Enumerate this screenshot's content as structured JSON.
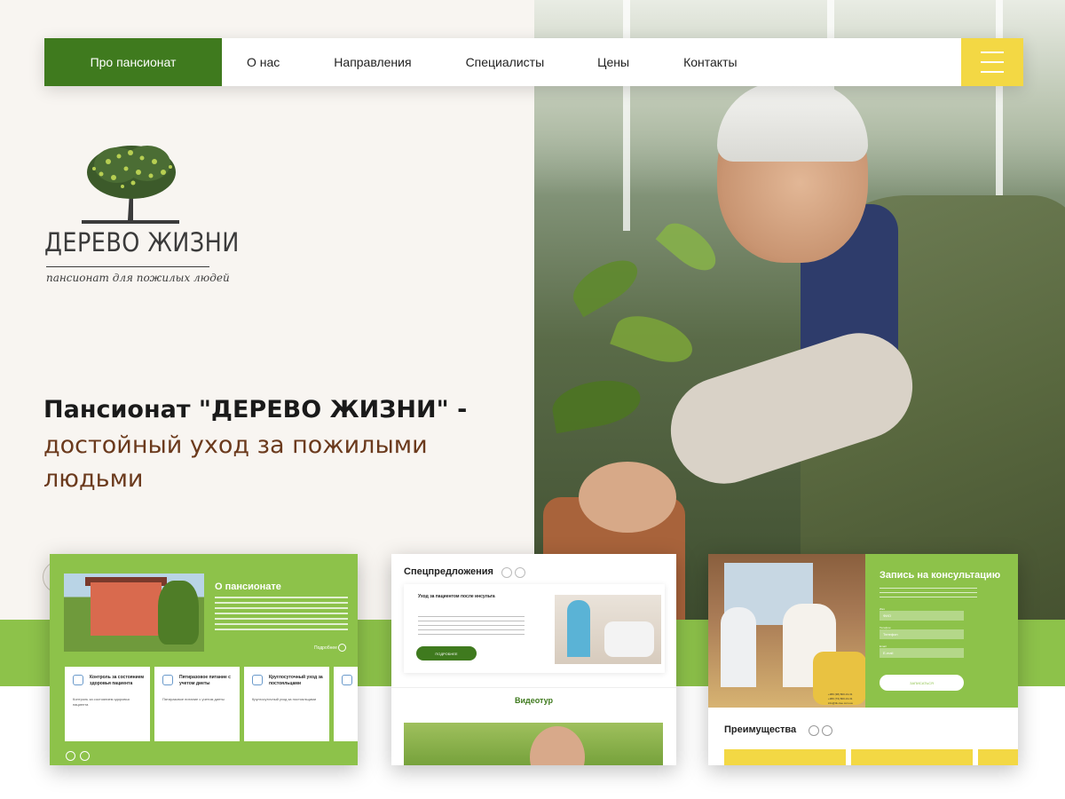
{
  "nav": {
    "items": [
      {
        "label": "Про пансионат",
        "active": true
      },
      {
        "label": "О нас"
      },
      {
        "label": "Направления"
      },
      {
        "label": "Специалисты"
      },
      {
        "label": "Цены"
      },
      {
        "label": "Контакты"
      }
    ],
    "menu_icon": "hamburger-icon",
    "accent": "#3f7a1e",
    "menu_color": "#f3d844"
  },
  "logo": {
    "brand": "ДЕРЕВО ЖИЗНИ",
    "tagline": "пансионат для пожилых людей"
  },
  "hero": {
    "title": "Пансионат  \"ДЕРЕВО ЖИЗНИ\" -",
    "subtitle": "достойный уход за пожилыми людьми"
  },
  "mockups": {
    "about": {
      "title": "О пансионате",
      "more": "Подробнее",
      "features": [
        {
          "title": "Контроль за состоянием здоровья пациента",
          "desc": "Контроль за состоянием здоровья пациента"
        },
        {
          "title": "Пятиразовое питание с учетом диеты",
          "desc": "Пятиразовое питание с учетом диеты"
        },
        {
          "title": "Круглосуточный уход за постояльцами",
          "desc": "Круглосуточный уход за постояльцами"
        }
      ]
    },
    "offers": {
      "title": "Спецпредложения",
      "offer_title": "Уход за пациентом после инсульта",
      "button": "ПОДРОБНЕЕ",
      "video_title": "Видеотур"
    },
    "consult": {
      "title": "Запись на консультацию",
      "fields": [
        {
          "label": "Имя",
          "value": "ФИО"
        },
        {
          "label": "Телефон",
          "value": "Телефон"
        },
        {
          "label": "Email",
          "value": "E-mail"
        }
      ],
      "submit": "ЗАПИСАТЬСЯ",
      "contacts": [
        "+380 (38) 800-13-31",
        "+380 (73) 800-13-31",
        "info@tik-tree.com.ua"
      ],
      "advantages_title": "Преимущества"
    }
  },
  "colors": {
    "green_band": "#8dc24a",
    "dark_green": "#3f7a1e",
    "brown_text": "#6b3a1d",
    "yellow": "#f3d844"
  }
}
